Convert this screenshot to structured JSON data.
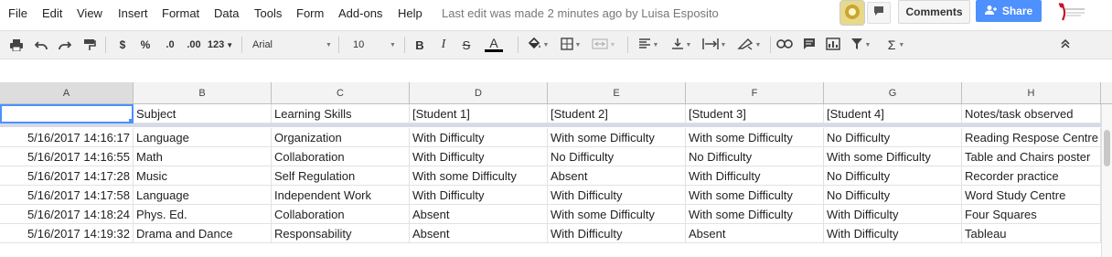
{
  "menu": [
    "File",
    "Edit",
    "View",
    "Insert",
    "Format",
    "Data",
    "Tools",
    "Form",
    "Add-ons",
    "Help"
  ],
  "last_edit": "Last edit was made 2 minutes ago by Luisa Esposito",
  "buttons": {
    "comments": "Comments",
    "share": "Share"
  },
  "toolbar": {
    "currency": "$",
    "percent": "%",
    "dec_decrease": ".0",
    "dec_increase": ".00",
    "more_formats": "123",
    "font": "Arial",
    "font_size": "10",
    "bold": "B",
    "italic": "I",
    "strike": "S",
    "text_color": "A",
    "sum": "Σ"
  },
  "colors": {
    "share_bg": "#4d90fe",
    "selection": "#4d90fe"
  },
  "columns": [
    "A",
    "B",
    "C",
    "D",
    "E",
    "F",
    "G",
    "H"
  ],
  "header_row": [
    "",
    "Subject",
    "Learning Skills",
    " [Student 1]",
    " [Student 2]",
    " [Student 3]",
    " [Student 4]",
    "Notes/task observed"
  ],
  "rows": [
    [
      "5/16/2017 14:16:17",
      "Language",
      "Organization",
      "With Difficulty",
      "With some Difficulty",
      "With some Difficulty",
      "No Difficulty",
      "Reading Respose Centre"
    ],
    [
      "5/16/2017 14:16:55",
      "Math",
      "Collaboration",
      "With Difficulty",
      "No Difficulty",
      "No Difficulty",
      "With some Difficulty",
      "Table and Chairs poster"
    ],
    [
      "5/16/2017 14:17:28",
      "Music",
      "Self Regulation",
      "With some Difficulty",
      "Absent",
      "With Difficulty",
      "No Difficulty",
      "Recorder practice"
    ],
    [
      "5/16/2017 14:17:58",
      "Language",
      "Independent Work",
      "With Difficulty",
      "With Difficulty",
      "With some Difficulty",
      "No Difficulty",
      "Word Study Centre"
    ],
    [
      "5/16/2017 14:18:24",
      "Phys. Ed.",
      "Collaboration",
      "Absent",
      "With some Difficulty",
      "With some Difficulty",
      "With Difficulty",
      "Four Squares"
    ],
    [
      "5/16/2017 14:19:32",
      "Drama and Dance",
      "Responsability",
      "Absent",
      "With Difficulty",
      "Absent",
      "With Difficulty",
      "Tableau"
    ]
  ]
}
